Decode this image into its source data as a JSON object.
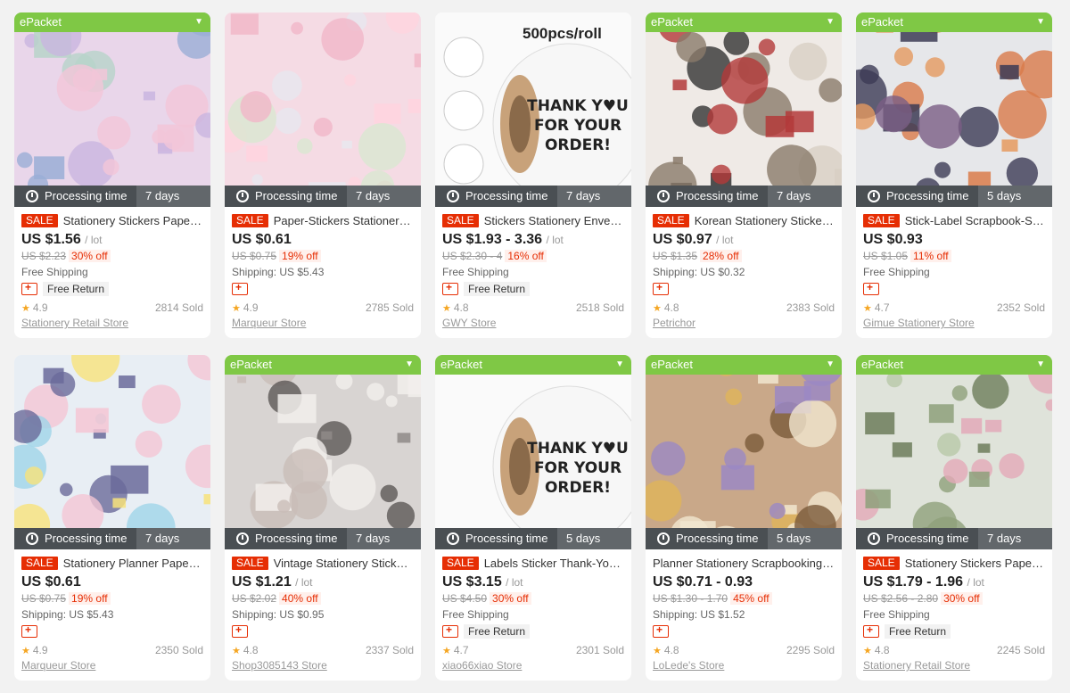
{
  "labels": {
    "epacket": "ePacket",
    "processing": "Processing time",
    "sale": "SALE",
    "free_return": "Free Return"
  },
  "products": [
    {
      "title": "Stationery Stickers Paper-...",
      "epacket": true,
      "days": "7 days",
      "sale": true,
      "price": "US $1.56",
      "unit": "/ lot",
      "orig": "US $2.23",
      "off": "30% off",
      "shipping": "Free Shipping",
      "free_return": true,
      "rating": "4.9",
      "sold": "2814 Sold",
      "store": "Stationery Retail Store",
      "palette": [
        "#e9d6ea",
        "#9aaed6",
        "#c9b5e0",
        "#f2c6d8",
        "#b7d3c9"
      ]
    },
    {
      "title": "Paper-Stickers Stationery ...",
      "epacket": false,
      "days": "7 days",
      "sale": true,
      "price": "US $0.61",
      "unit": "",
      "orig": "US $0.75",
      "off": "19% off",
      "shipping": "Shipping: US $5.43",
      "free_return": false,
      "rating": "4.9",
      "sold": "2785 Sold",
      "store": "Marqueur Store",
      "palette": [
        "#f5dbe4",
        "#f1b7c8",
        "#e7e7ef",
        "#ffd4df",
        "#d9e7d1"
      ]
    },
    {
      "title": "Stickers Stationery Envelo...",
      "epacket": false,
      "days": "7 days",
      "sale": true,
      "price": "US $1.93 - 3.36",
      "unit": "/ lot",
      "orig": "US $2.30 - 4",
      "off": "16% off",
      "shipping": "Free Shipping",
      "free_return": true,
      "rating": "4.8",
      "sold": "2518 Sold",
      "store": "GWY Store",
      "palette": [
        "#ffffff",
        "#f3f3f3",
        "#cc1f35",
        "#c8a27a",
        "#444444"
      ],
      "overlay": "500pcs/roll"
    },
    {
      "title": "Korean Stationery Stickers...",
      "epacket": true,
      "days": "7 days",
      "sale": true,
      "price": "US $0.97",
      "unit": "/ lot",
      "orig": "US $1.35",
      "off": "28% off",
      "shipping": "Shipping: US $0.32",
      "free_return": false,
      "rating": "4.8",
      "sold": "2383 Sold",
      "store": "Petrichor",
      "palette": [
        "#efeae6",
        "#333333",
        "#b33a3a",
        "#8a7a6a",
        "#d8cfc4"
      ]
    },
    {
      "title": "Stick-Label Scrapbook-Stic...",
      "epacket": true,
      "days": "5 days",
      "sale": true,
      "price": "US $0.93",
      "unit": "",
      "orig": "US $1.05",
      "off": "11% off",
      "shipping": "Free Shipping",
      "free_return": false,
      "rating": "4.7",
      "sold": "2352 Sold",
      "store": "Gimue Stationery Store",
      "palette": [
        "#e6e7ea",
        "#e59a5f",
        "#7b5e85",
        "#d97b4a",
        "#3c3b55"
      ]
    },
    {
      "title": "Stationery Planner Paper-...",
      "epacket": false,
      "days": "7 days",
      "sale": true,
      "price": "US $0.61",
      "unit": "",
      "orig": "US $0.75",
      "off": "19% off",
      "shipping": "Shipping: US $5.43",
      "free_return": false,
      "rating": "4.9",
      "sold": "2350 Sold",
      "store": "Marqueur Store",
      "palette": [
        "#e8eef4",
        "#9fd4e8",
        "#f4c6d4",
        "#f7e27a",
        "#6a6a9a"
      ]
    },
    {
      "title": "Vintage Stationery Sticker...",
      "epacket": true,
      "days": "7 days",
      "sale": true,
      "price": "US $1.21",
      "unit": "/ lot",
      "orig": "US $2.02",
      "off": "40% off",
      "shipping": "Shipping: US $0.95",
      "free_return": false,
      "rating": "4.8",
      "sold": "2337 Sold",
      "store": "Shop3085143 Store",
      "palette": [
        "#d8d4d2",
        "#8f8a88",
        "#c9bdb8",
        "#f2efec",
        "#5d5856"
      ]
    },
    {
      "title": "Labels Sticker Thank-You ...",
      "epacket": true,
      "days": "5 days",
      "sale": true,
      "price": "US $3.15",
      "unit": "/ lot",
      "orig": "US $4.50",
      "off": "30% off",
      "shipping": "Free Shipping",
      "free_return": true,
      "rating": "4.7",
      "sold": "2301 Sold",
      "store": "xiao66xiao Store",
      "palette": [
        "#ffffff",
        "#f3f3f3",
        "#cc1f35",
        "#c8a27a",
        "#444444"
      ]
    },
    {
      "title": "Planner Stationery Scrapbooking S...",
      "epacket": true,
      "days": "5 days",
      "sale": false,
      "price": "US $0.71 - 0.93",
      "unit": "",
      "orig": "US $1.30 - 1.70",
      "off": "45% off",
      "shipping": "Shipping: US $1.52",
      "free_return": false,
      "rating": "4.8",
      "sold": "2295 Sold",
      "store": "LoLede's Store",
      "palette": [
        "#c9a889",
        "#f1e6d0",
        "#9b88c4",
        "#e0b45a",
        "#7a5a3a"
      ]
    },
    {
      "title": "Stationery Stickers Paper ...",
      "epacket": true,
      "days": "7 days",
      "sale": true,
      "price": "US $1.79 - 1.96",
      "unit": "/ lot",
      "orig": "US $2.56 - 2.80",
      "off": "30% off",
      "shipping": "Free Shipping",
      "free_return": true,
      "rating": "4.8",
      "sold": "2245 Sold",
      "store": "Stationery Retail Store",
      "palette": [
        "#dfe3da",
        "#8ea07a",
        "#e3a9b8",
        "#b8c8a8",
        "#6d7d5a"
      ]
    }
  ]
}
